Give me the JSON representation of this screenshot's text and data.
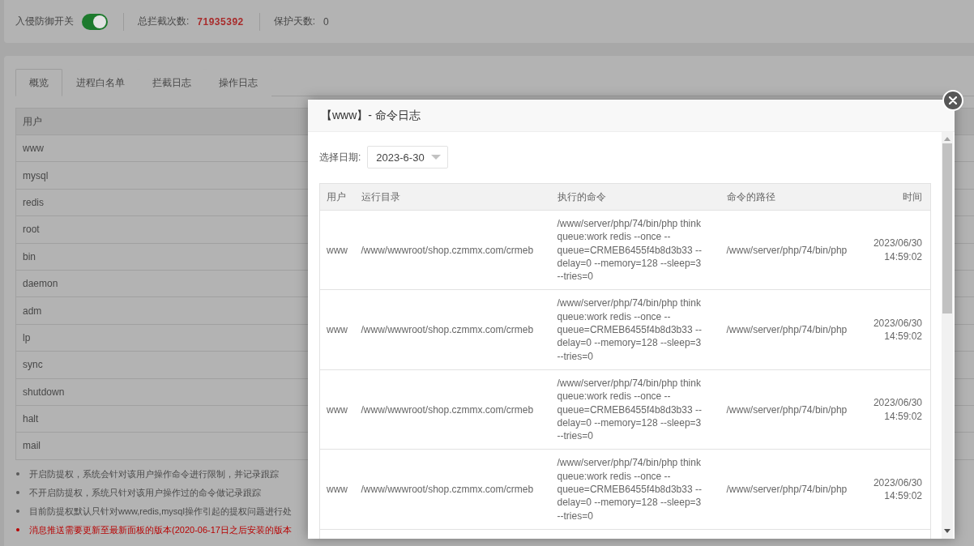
{
  "header": {
    "defense_switch": {
      "label": "入侵防御开关",
      "on": true
    },
    "stats": [
      {
        "label": "总拦截次数:",
        "value": "71935392",
        "kind": "alert"
      },
      {
        "label": "保护天数:",
        "value": "0",
        "kind": "plain"
      }
    ]
  },
  "tabs": [
    {
      "label": "概览",
      "selected": true
    },
    {
      "label": "进程白名单",
      "selected": false
    },
    {
      "label": "拦截日志",
      "selected": false
    },
    {
      "label": "操作日志",
      "selected": false
    }
  ],
  "users_table": {
    "columns": [
      "用户"
    ],
    "rows": [
      "www",
      "mysql",
      "redis",
      "root",
      "bin",
      "daemon",
      "adm",
      "lp",
      "sync",
      "shutdown",
      "halt",
      "mail"
    ]
  },
  "notes": [
    {
      "kind": "info",
      "text": "开启防提权，系统会针对该用户操作命令进行限制，并记录跟踪"
    },
    {
      "kind": "info",
      "text": "不开启防提权，系统只针对该用户操作过的命令做记录跟踪"
    },
    {
      "kind": "info",
      "text": "目前防提权默认只针对www,redis,mysql操作引起的提权问题进行处"
    },
    {
      "kind": "warning",
      "text": "消息推送需要更新至最新面板的版本(2020-06-17日之后安装的版本"
    }
  ],
  "dialog": {
    "title": "【www】- 命令日志",
    "date_filter": {
      "label": "选择日期:",
      "value": "2023-6-30"
    },
    "table": {
      "columns": [
        "用户",
        "运行目录",
        "执行的命令",
        "命令的路径",
        "时间"
      ],
      "rows": [
        [
          "www",
          "/www/wwwroot/shop.czmmx.com/crmeb",
          "/www/server/php/74/bin/php think queue:work redis --once --queue=CRMEB6455f4b8d3b33 --delay=0 --memory=128 --sleep=3 --tries=0",
          "/www/server/php/74/bin/php",
          "2023/06/30 14:59:02"
        ],
        [
          "www",
          "/www/wwwroot/shop.czmmx.com/crmeb",
          "/www/server/php/74/bin/php think queue:work redis --once --queue=CRMEB6455f4b8d3b33 --delay=0 --memory=128 --sleep=3 --tries=0",
          "/www/server/php/74/bin/php",
          "2023/06/30 14:59:02"
        ],
        [
          "www",
          "/www/wwwroot/shop.czmmx.com/crmeb",
          "/www/server/php/74/bin/php think queue:work redis --once --queue=CRMEB6455f4b8d3b33 --delay=0 --memory=128 --sleep=3 --tries=0",
          "/www/server/php/74/bin/php",
          "2023/06/30 14:59:02"
        ],
        [
          "www",
          "/www/wwwroot/shop.czmmx.com/crmeb",
          "/www/server/php/74/bin/php think queue:work redis --once --queue=CRMEB6455f4b8d3b33 --delay=0 --memory=128 --sleep=3 --tries=0",
          "/www/server/php/74/bin/php",
          "2023/06/30 14:59:02"
        ]
      ]
    }
  }
}
